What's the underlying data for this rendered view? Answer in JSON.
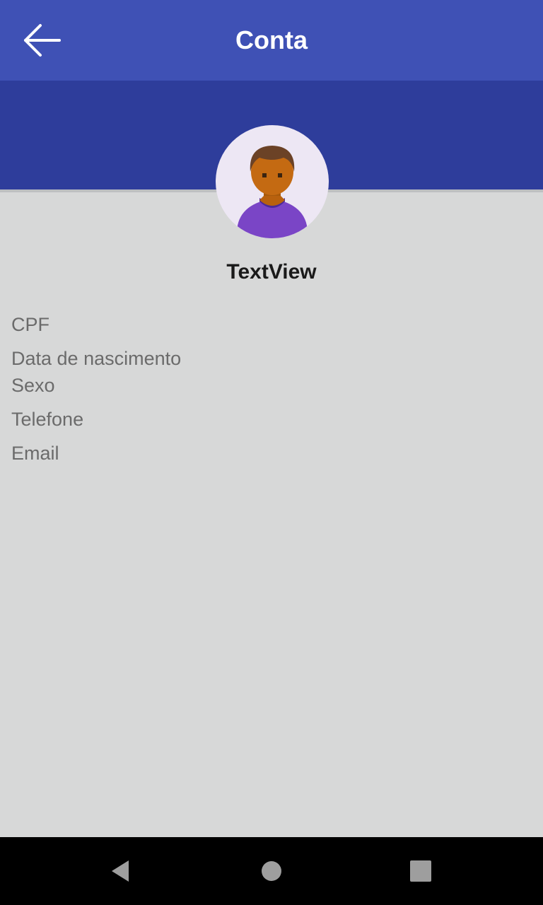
{
  "appbar": {
    "title": "Conta",
    "back_icon": "arrow-left-icon"
  },
  "profile": {
    "avatar_icon": "person-avatar-icon",
    "name": "TextView"
  },
  "fields": {
    "cpf": "CPF",
    "birth_date": "Data de nascimento",
    "sex": "Sexo",
    "phone": "Telefone",
    "email": "Email"
  },
  "navbar": {
    "back_icon": "triangle-back-icon",
    "home_icon": "circle-home-icon",
    "recents_icon": "square-recents-icon"
  },
  "colors": {
    "appbar": "#3f51b5",
    "profile_band": "#2e3d9b",
    "background": "#d7d8d8",
    "field_text": "#6b6b6b"
  }
}
